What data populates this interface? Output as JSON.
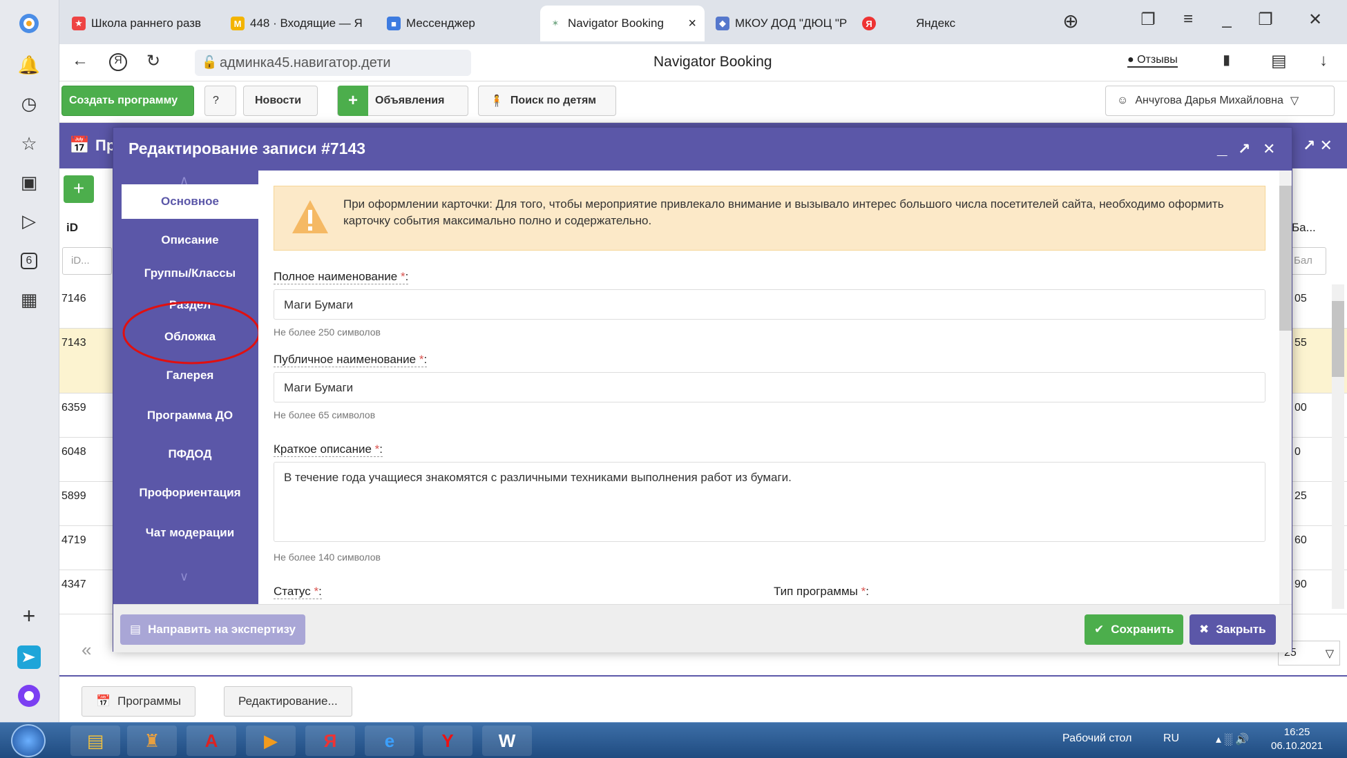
{
  "browser": {
    "tabs": [
      {
        "label": "Школа раннего разв",
        "color": "#e44"
      },
      {
        "label": "448 · Входящие — Я",
        "color": "#f3b400"
      },
      {
        "label": "Мессенджер",
        "color": "#3d7be0"
      },
      {
        "label": "Navigator Booking",
        "color": "#7a8",
        "active": true
      },
      {
        "label": "МКОУ ДОД \"ДЮЦ \"Р",
        "color": "#5577cc"
      },
      {
        "label": "Яндекс",
        "color": "#e33"
      }
    ],
    "tab_close": "×",
    "url": "админка45.навигатор.дети",
    "page_title": "Navigator Booking",
    "reviews_label": "Отзывы"
  },
  "rail": {
    "badge_number": "6"
  },
  "toolbar": {
    "create_program": "Создать программу",
    "news": "Новости",
    "announcements": "Объявления",
    "search_children": "Поиск по детям",
    "user_name": "Анчугова Дарья Михайловна"
  },
  "background_list": {
    "header_prefix": "Пр",
    "id_header": "iD",
    "id_filter_placeholder": "iD...",
    "right_header": "Ба...",
    "right_filter": "Бал",
    "rows": [
      {
        "id": "7146",
        "right": "05"
      },
      {
        "id": "7143",
        "right": "55"
      },
      {
        "id": "6359",
        "right": "00"
      },
      {
        "id": "6048",
        "right": "0"
      },
      {
        "id": "5899",
        "right": "25"
      },
      {
        "id": "4719",
        "right": "60"
      },
      {
        "id": "4347",
        "right": "90"
      }
    ],
    "page_size": "25"
  },
  "modal": {
    "title": "Редактирование записи #7143",
    "side_items": [
      {
        "label": "Основное",
        "active": true
      },
      {
        "label": "Описание"
      },
      {
        "label": "Группы/Классы"
      },
      {
        "label": "Раздел"
      },
      {
        "label": "Обложка"
      },
      {
        "label": "Галерея"
      },
      {
        "label": "Программа ДО"
      },
      {
        "label": "ПФДОД"
      },
      {
        "label": "Профориентация"
      },
      {
        "label": "Чат модерации"
      }
    ],
    "warning": "При оформлении карточки: Для того, чтобы мероприятие привлекало внимание и вызывало интерес большого числа посетителей сайта, необходимо оформить карточку события максимально полно и содержательно.",
    "fields": {
      "full_name_label": "Полное наименование",
      "full_name_value": "Маги Бумаги",
      "full_name_hint": "Не более 250 символов",
      "public_name_label": "Публичное наименование",
      "public_name_value": "Маги Бумаги",
      "public_name_hint": "Не более 65 символов",
      "short_desc_label": "Краткое описание",
      "short_desc_value": "В течение года учащиеся знакомятся с различными техниками выполнения работ из бумаги.",
      "short_desc_hint": "Не более 140 символов",
      "status_label": "Статус",
      "program_type_label": "Тип программы",
      "required_mark": "*",
      "colon": ":"
    },
    "footer": {
      "send_expert": "Направить на экспертизу",
      "save": "Сохранить",
      "close": "Закрыть"
    }
  },
  "inner_taskbar": {
    "programs": "Программы",
    "editing": "Редактирование..."
  },
  "windows_taskbar": {
    "desktop": "Рабочий стол",
    "lang": "RU",
    "time": "16:25",
    "date": "06.10.2021"
  }
}
